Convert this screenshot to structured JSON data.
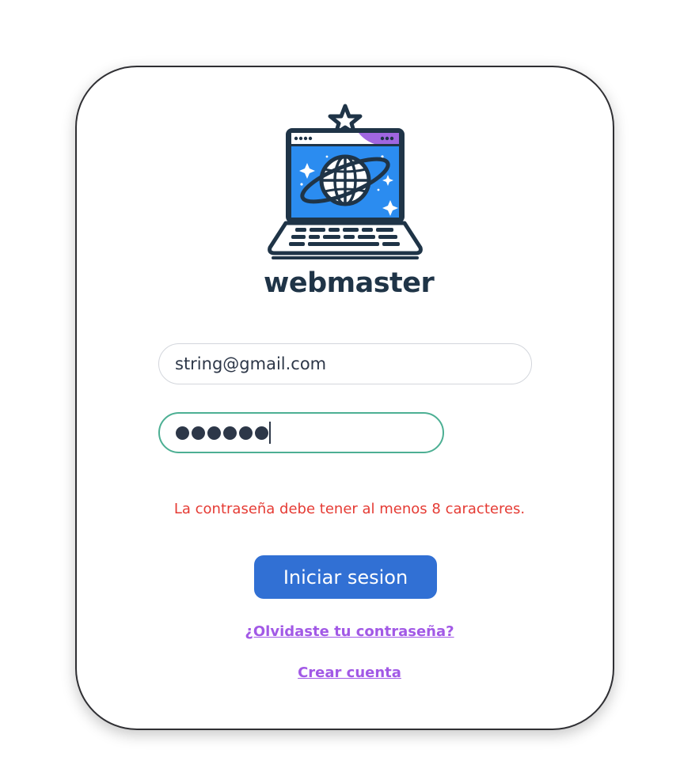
{
  "brand": {
    "name": "webmaster"
  },
  "form": {
    "email_value": "string@gmail.com",
    "password_mask_length": 6,
    "error_message": "La contraseña debe tener al menos 8 caracteres.",
    "submit_label": "Iniciar sesion",
    "forgot_link": "¿Olvidaste tu contraseña?",
    "create_link": "Crear cuenta"
  },
  "colors": {
    "primary": "#3170d4",
    "error": "#e53b34",
    "link": "#a259e6",
    "focus_border": "#4caf93",
    "brand_text": "#1f3447"
  },
  "icons": {
    "logo": "laptop-planet-icon"
  }
}
